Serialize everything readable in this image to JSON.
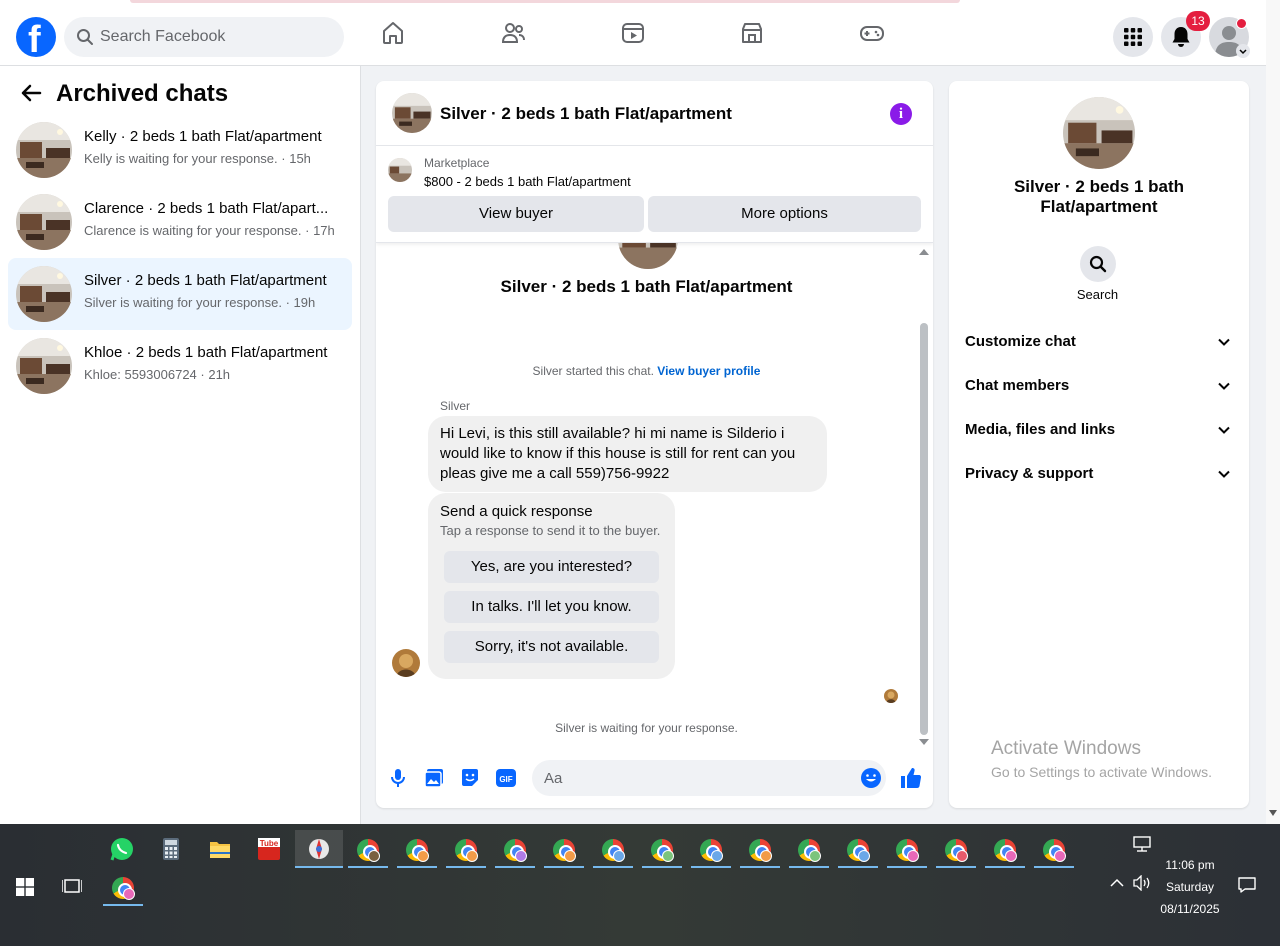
{
  "header": {
    "logo_letter": "f",
    "search_placeholder": "Search Facebook",
    "notifications_badge": "13",
    "nav_icons": [
      "home-icon",
      "friends-icon",
      "video-icon",
      "marketplace-icon",
      "gaming-icon"
    ],
    "right_icons": [
      "menu-grid-icon",
      "bell-icon",
      "account-avatar"
    ]
  },
  "sidebar": {
    "title": "Archived chats",
    "chats": [
      {
        "name": "Kelly · 2 beds 1 bath Flat/apartment",
        "preview": "Kelly is waiting for your response.",
        "time": "15h"
      },
      {
        "name": "Clarence · 2 beds 1 bath Flat/apart...",
        "preview": "Clarence is waiting for your response.",
        "time": "17h"
      },
      {
        "name": "Silver · 2 beds 1 bath Flat/apartment",
        "preview": "Silver is waiting for your response.",
        "time": "19h"
      },
      {
        "name": "Khloe · 2 beds 1 bath Flat/apartment",
        "preview": "Khloe: 5593006724",
        "time": "21h"
      }
    ]
  },
  "chat": {
    "title": "Silver · 2 beds 1 bath Flat/apartment",
    "marketplace_label": "Marketplace",
    "listing": "$800 - 2 beds 1 bath Flat/apartment",
    "view_buyer": "View buyer",
    "more_options": "More options",
    "intro_name": "Silver · 2 beds 1 bath Flat/apartment",
    "started_text": "Silver started this chat.",
    "view_profile": "View buyer profile",
    "sender": "Silver",
    "message": "Hi Levi, is this still available?  hi mi name is Silderio i would like to know if this house is still for rent can you pleas give me a call 559)756-9922",
    "quick_title": "Send a quick response",
    "quick_sub": "Tap a response to send it to the buyer.",
    "quick_replies": [
      "Yes, are you interested?",
      "In talks. I'll let you know.",
      "Sorry, it's not available."
    ],
    "waiting": "Silver is waiting for your response.",
    "composer_placeholder": "Aa"
  },
  "details": {
    "name": "Silver · 2 beds 1 bath Flat/apartment",
    "search_label": "Search",
    "sections": [
      "Customize chat",
      "Chat members",
      "Media, files and links",
      "Privacy & support"
    ]
  },
  "watermark": {
    "line1": "Activate Windows",
    "line2": "Go to Settings to activate Windows."
  },
  "taskbar": {
    "time": "11:06 pm",
    "day": "Saturday",
    "date": "08/11/2025"
  }
}
